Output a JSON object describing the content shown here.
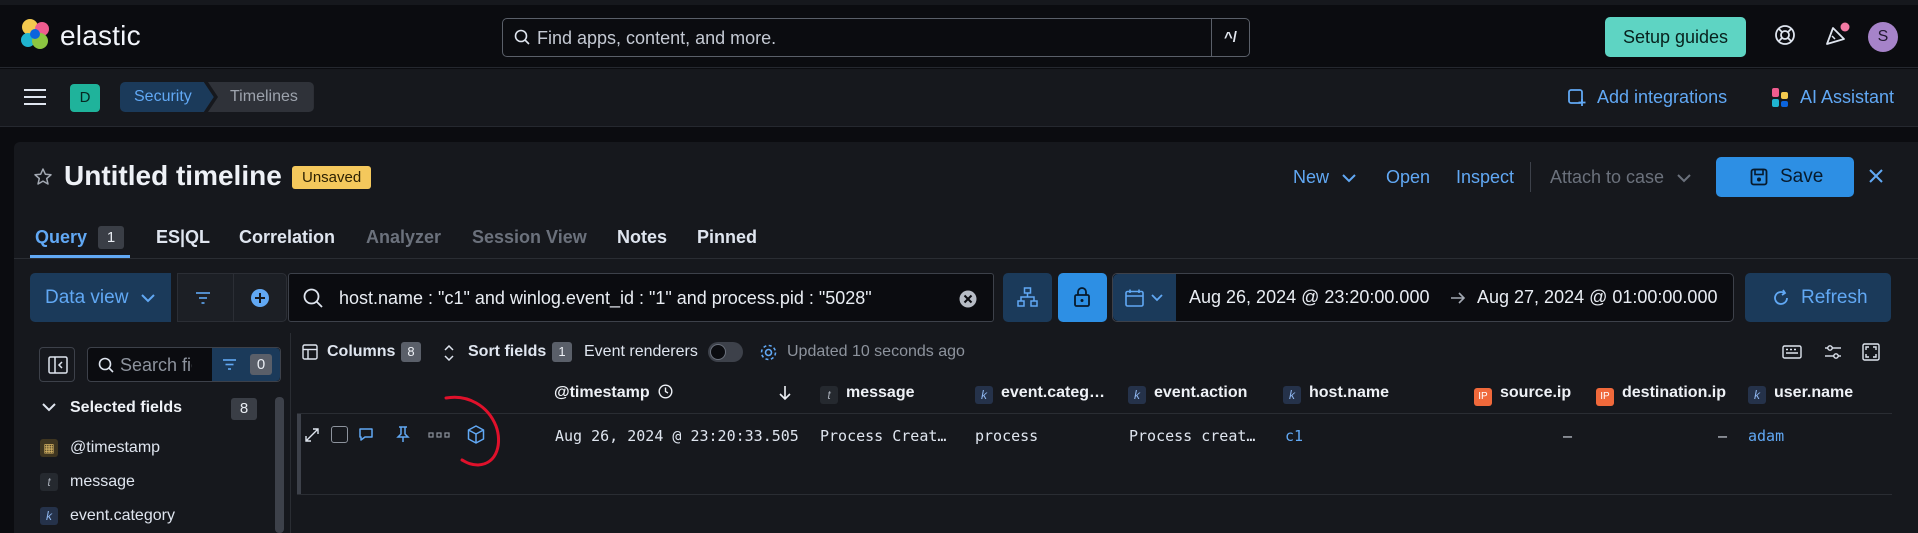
{
  "app": {
    "brand": "elastic",
    "search_placeholder": "Find apps, content, and more.",
    "search_shortcut": "^/",
    "setup_guides": "Setup guides",
    "avatar_initial": "S"
  },
  "nav": {
    "space_initial": "D",
    "breadcrumbs": [
      "Security",
      "Timelines"
    ],
    "add_integrations": "Add integrations",
    "ai_assistant": "AI Assistant"
  },
  "timeline": {
    "title": "Untitled timeline",
    "status": "Unsaved",
    "actions": {
      "new": "New",
      "open": "Open",
      "inspect": "Inspect",
      "attach": "Attach to case",
      "save": "Save"
    },
    "tabs": [
      {
        "label": "Query",
        "count": "1"
      },
      {
        "label": "ES|QL"
      },
      {
        "label": "Correlation"
      },
      {
        "label": "Analyzer"
      },
      {
        "label": "Session View"
      },
      {
        "label": "Notes"
      },
      {
        "label": "Pinned"
      }
    ]
  },
  "query_bar": {
    "data_view": "Data view",
    "query": "host.name : \"c1\" and winlog.event_id : \"1\" and process.pid : \"5028\"",
    "date_start": "Aug 26, 2024 @ 23:20:00.000",
    "date_end": "Aug 27, 2024 @ 01:00:00.000",
    "refresh": "Refresh"
  },
  "sidebar": {
    "search_placeholder": "Search field names",
    "filter_count": "0",
    "selected_fields_label": "Selected fields",
    "selected_count": "8",
    "fields": [
      {
        "name": "@timestamp",
        "type": "date"
      },
      {
        "name": "message",
        "type": "t"
      },
      {
        "name": "event.category",
        "type": "k"
      }
    ]
  },
  "toolbar": {
    "columns": "Columns",
    "columns_count": "8",
    "sort_fields": "Sort fields",
    "sort_count": "1",
    "event_renderers": "Event renderers",
    "updated": "Updated 10 seconds ago"
  },
  "table": {
    "columns": [
      {
        "label": "@timestamp",
        "type": ""
      },
      {
        "label": "message",
        "type": "t"
      },
      {
        "label": "event.categ…",
        "type": "k"
      },
      {
        "label": "event.action",
        "type": "k"
      },
      {
        "label": "host.name",
        "type": "k"
      },
      {
        "label": "source.ip",
        "type": "ip"
      },
      {
        "label": "destination.ip",
        "type": "ip"
      },
      {
        "label": "user.name",
        "type": "k"
      }
    ],
    "rows": [
      {
        "timestamp": "Aug 26, 2024 @ 23:20:33.505",
        "message": "Process Creat…",
        "category": "process",
        "action": "Process creat…",
        "host": "c1",
        "source_ip": "–",
        "destination_ip": "–",
        "user": "adam"
      }
    ]
  },
  "colors": {
    "accent": "#61a8f4",
    "primary_button": "#2d8fe4",
    "setup_button": "#5ed4c3",
    "unsaved_badge": "#f4c85c",
    "annotation": "#e0112b"
  }
}
